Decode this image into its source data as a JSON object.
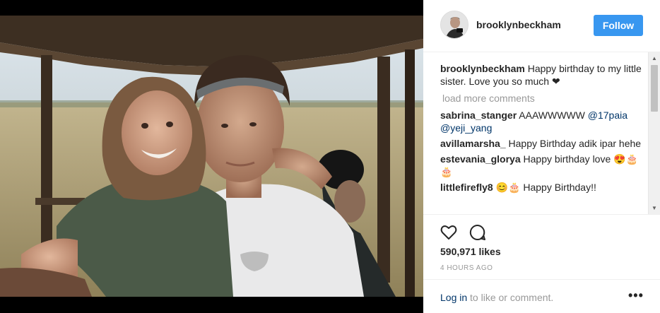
{
  "post": {
    "username": "brooklynbeckham",
    "follow_label": "Follow"
  },
  "comments": [
    {
      "user": "brooklynbeckham",
      "text": " Happy birthday to my little sister. Love you so much ❤"
    }
  ],
  "load_more_label": "load more comments",
  "replies": [
    {
      "user": "sabrina_stanger",
      "text": " AAAWWWWW ",
      "mentions": [
        "@17paia",
        "@yeji_yang"
      ]
    },
    {
      "user": "avillamarsha_",
      "text": " Happy Birthday adik ipar hehe"
    },
    {
      "user": "estevania_glorya",
      "text": " Happy birthday love 😍🎂🎂"
    },
    {
      "user": "littlefirefly8",
      "text": " 😊🎂 Happy Birthday!!"
    }
  ],
  "likes_count": "590,971 likes",
  "time_ago": "4 HOURS AGO",
  "footer": {
    "login_label": "Log in",
    "login_suffix": " to like or comment.",
    "more_label": "•••"
  },
  "icons": {
    "like": "heart-outline-icon",
    "comment": "speech-bubble-icon",
    "more": "more-options-icon",
    "scroll_up": "triangle-up-icon",
    "scroll_down": "triangle-down-icon"
  },
  "colors": {
    "accent": "#3897f0",
    "link": "#003569",
    "muted": "#999999",
    "text": "#262626"
  }
}
